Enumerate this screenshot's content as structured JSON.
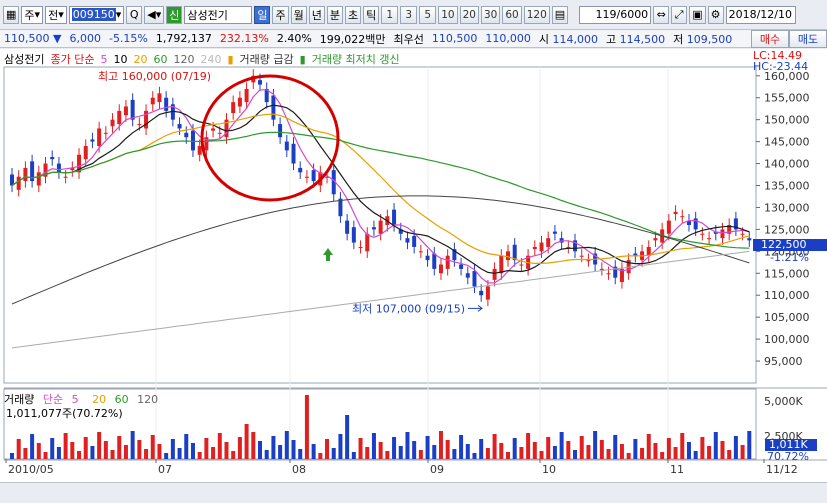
{
  "toolbar": {
    "market": "주",
    "jeon": "전",
    "code": "009150",
    "sin": "신",
    "stock_name": "삼성전기",
    "periods": [
      "일",
      "주",
      "월",
      "년",
      "분",
      "초",
      "틱"
    ],
    "active_period": "일",
    "nums": [
      "1",
      "3",
      "5",
      "10",
      "20",
      "30",
      "60",
      "120"
    ],
    "count": "119",
    "total": "/6000",
    "date": "2018/12/10"
  },
  "quote": {
    "price": "110,500",
    "arrow": "▼",
    "change": "6,000",
    "change_pct": "-5.15%",
    "volume": "1,792,137",
    "volume_pct": "232.13%",
    "turnover_pct": "2.40%",
    "amount": "199,022백만",
    "best_label": "최우선",
    "best_sell": "110,500",
    "best_buy": "110,000",
    "open_label": "시",
    "open": "114,000",
    "high_label": "고",
    "high": "114,500",
    "low_label": "저",
    "low": "109,500",
    "buy_btn": "매수",
    "sell_btn": "매도"
  },
  "legend": {
    "name": "삼성전기",
    "ma_label": "종가 단순",
    "ma5": "5",
    "ma10": "10",
    "ma20": "20",
    "ma60": "60",
    "ma120": "120",
    "ma240": "240",
    "vol_drop": "거래량 급감",
    "vol_low": "거래량 최저치 갱신"
  },
  "volume_legend": {
    "label": "거래량",
    "ma_label": "단순",
    "ma5": "5",
    "ma20": "20",
    "ma60": "60",
    "ma120": "120",
    "value": "1,011,077주(70.72%)"
  },
  "right_panel": {
    "lc": "LC:14.49",
    "hc": "HC:-23.44",
    "current": "122,500",
    "current_pct": "-1.21%",
    "vol_current": "1,011K",
    "vol_pct": "70.72%"
  },
  "colors": {
    "up": "#e02020",
    "down": "#1a3fc4",
    "ma5": "#d14ad1",
    "ma10": "#1a1a1a",
    "ma20": "#e6a000",
    "ma60": "#2e9a2e",
    "ma120": "#444444",
    "ma240": "#aaaaaa",
    "circle": "#d40000"
  },
  "chart_data": {
    "type": "candlestick",
    "ylim": [
      90000,
      162000
    ],
    "y_ticks": [
      "160,000",
      "155,000",
      "150,000",
      "145,000",
      "140,000",
      "135,000",
      "130,000",
      "125,000",
      "120,000",
      "115,000",
      "110,000",
      "105,000",
      "100,000",
      "95,000"
    ],
    "x_ticks": [
      "2010/05",
      "07",
      "08",
      "09",
      "10",
      "11",
      "11/12"
    ],
    "annotations": {
      "high": "최고 160,000 (07/19)",
      "low": "최저 107,000 (09/15)"
    },
    "volume_ticks": [
      "5,000K",
      "2,500K"
    ],
    "close": [
      135000,
      137000,
      139000,
      136000,
      138000,
      140000,
      141000,
      138000,
      137000,
      139000,
      142000,
      144000,
      145000,
      148000,
      147000,
      150000,
      152000,
      153000,
      150000,
      149000,
      152000,
      155000,
      156000,
      152000,
      150000,
      148000,
      146000,
      143000,
      144000,
      146000,
      148000,
      147000,
      150000,
      154000,
      155000,
      157000,
      160000,
      158000,
      154000,
      150000,
      146000,
      143000,
      140000,
      138000,
      137000,
      136000,
      138000,
      137000,
      133000,
      128000,
      124000,
      122000,
      121000,
      124000,
      125000,
      127000,
      128000,
      126000,
      124000,
      122000,
      121000,
      120000,
      118000,
      116000,
      117000,
      119000,
      118000,
      116000,
      114000,
      112000,
      110000,
      112000,
      116000,
      119000,
      120000,
      118000,
      117000,
      119000,
      121000,
      122000,
      123000,
      124000,
      122000,
      121000,
      120000,
      119000,
      118000,
      117000,
      116000,
      115000,
      114000,
      116000,
      118000,
      119000,
      120000,
      121000,
      123000,
      125000,
      127000,
      129000,
      128000,
      126000,
      125000,
      124000,
      123000,
      124000,
      125000,
      126000,
      125000,
      124000,
      122500
    ]
  }
}
